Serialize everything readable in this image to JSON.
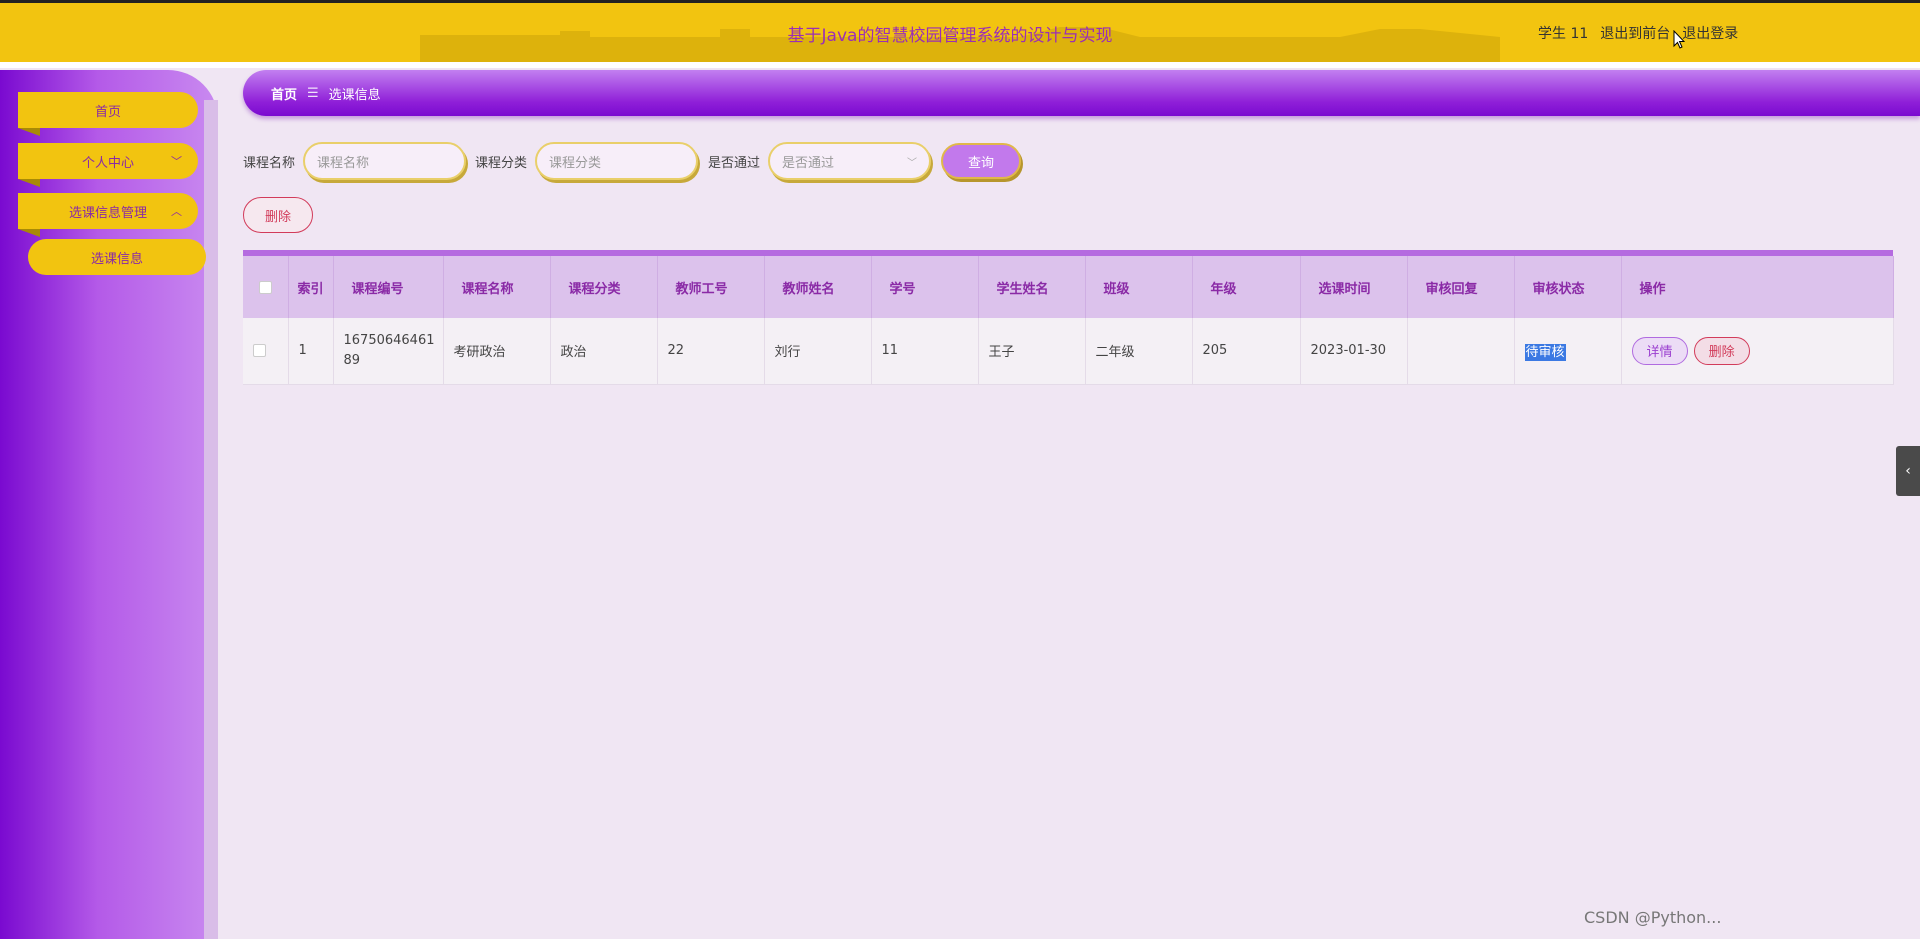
{
  "header": {
    "title": "基于Java的智慧校园管理系统的设计与实现",
    "user": "学生 11",
    "to_front": "退出到前台",
    "logout": "退出登录"
  },
  "sidebar": {
    "items": [
      {
        "label": "首页"
      },
      {
        "label": "个人中心",
        "chevron": "﹀"
      },
      {
        "label": "选课信息管理",
        "chevron": "︿"
      }
    ],
    "sub_items": [
      {
        "label": "选课信息"
      }
    ]
  },
  "breadcrumb": {
    "home": "首页",
    "separator": "☰",
    "current": "选课信息"
  },
  "filters": {
    "course_name_label": "课程名称",
    "course_name_placeholder": "课程名称",
    "course_type_label": "课程分类",
    "course_type_placeholder": "课程分类",
    "passed_label": "是否通过",
    "passed_placeholder": "是否通过",
    "query": "查询"
  },
  "actions": {
    "delete": "删除"
  },
  "table": {
    "headers": [
      "",
      "索引",
      "课程编号",
      "课程名称",
      "课程分类",
      "教师工号",
      "教师姓名",
      "学号",
      "学生姓名",
      "班级",
      "年级",
      "选课时间",
      "审核回复",
      "审核状态",
      "操作"
    ],
    "rows": [
      {
        "index": "1",
        "course_no": "1675064646189",
        "course_name": "考研政治",
        "course_type": "政治",
        "teacher_no": "22",
        "teacher_name": "刘行",
        "student_no": "11",
        "student_name": "王子",
        "class": "二年级",
        "grade": "205",
        "time": "2023-01-30",
        "reply": "",
        "status": "待审核",
        "detail": "详情",
        "delete": "删除"
      }
    ]
  },
  "watermark": "CSDN @Python..."
}
